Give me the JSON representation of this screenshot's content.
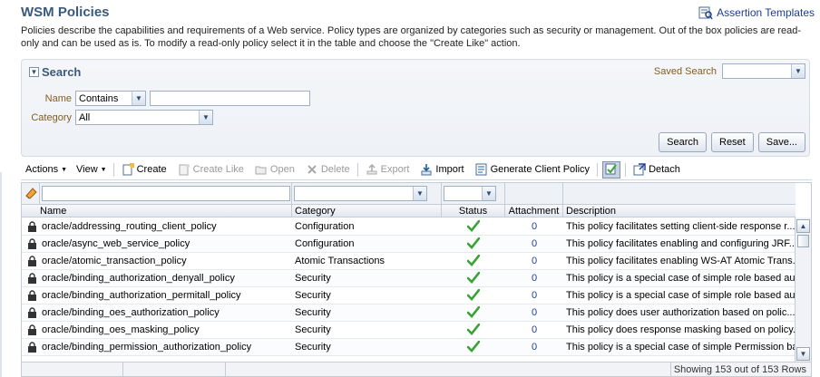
{
  "page": {
    "title": "WSM Policies",
    "assertion_link": "Assertion Templates",
    "description": "Policies describe the capabilities and requirements of a Web service. Policy types are organized by categories such as security or management. Out of the box policies are read-only and can be used as is. To modify a read-only policy select it in the table and choose the \"Create Like\" action."
  },
  "search": {
    "heading": "Search",
    "saved_search_label": "Saved Search",
    "saved_search_value": "",
    "name_label": "Name",
    "name_operator": "Contains",
    "name_value": "",
    "category_label": "Category",
    "category_value": "All",
    "buttons": {
      "search": "Search",
      "reset": "Reset",
      "save": "Save..."
    }
  },
  "toolbar": {
    "actions": "Actions",
    "view": "View",
    "create": "Create",
    "create_like": "Create Like",
    "open": "Open",
    "delete": "Delete",
    "export": "Export",
    "import": "Import",
    "generate_client_policy": "Generate Client Policy",
    "detach": "Detach"
  },
  "table": {
    "columns": {
      "name": "Name",
      "category": "Category",
      "status": "Status",
      "attachment": "Attachment",
      "description": "Description"
    },
    "rows": [
      {
        "name": "oracle/addressing_routing_client_policy",
        "category": "Configuration",
        "attachment": "0",
        "description": "This policy facilitates setting client-side response r..."
      },
      {
        "name": "oracle/async_web_service_policy",
        "category": "Configuration",
        "attachment": "0",
        "description": "This policy facilitates enabling and configuring JRF..."
      },
      {
        "name": "oracle/atomic_transaction_policy",
        "category": "Atomic Transactions",
        "attachment": "0",
        "description": "This policy facilitates enabling WS-AT Atomic Trans..."
      },
      {
        "name": "oracle/binding_authorization_denyall_policy",
        "category": "Security",
        "attachment": "0",
        "description": "This policy is a special case of simple role based au..."
      },
      {
        "name": "oracle/binding_authorization_permitall_policy",
        "category": "Security",
        "attachment": "0",
        "description": "This policy is a special case of simple role based au..."
      },
      {
        "name": "oracle/binding_oes_authorization_policy",
        "category": "Security",
        "attachment": "0",
        "description": "This policy does user authorization based on polic..."
      },
      {
        "name": "oracle/binding_oes_masking_policy",
        "category": "Security",
        "attachment": "0",
        "description": "This policy does response masking based on policy..."
      },
      {
        "name": "oracle/binding_permission_authorization_policy",
        "category": "Security",
        "attachment": "0",
        "description": "This policy is a special case of simple Permission ba..."
      }
    ],
    "footer": "Showing 153 out of 153 Rows"
  },
  "colors": {
    "title": "#3a5a7c",
    "link": "#1f3e91",
    "label": "#825e1e",
    "status_ok": "#3aa335"
  }
}
